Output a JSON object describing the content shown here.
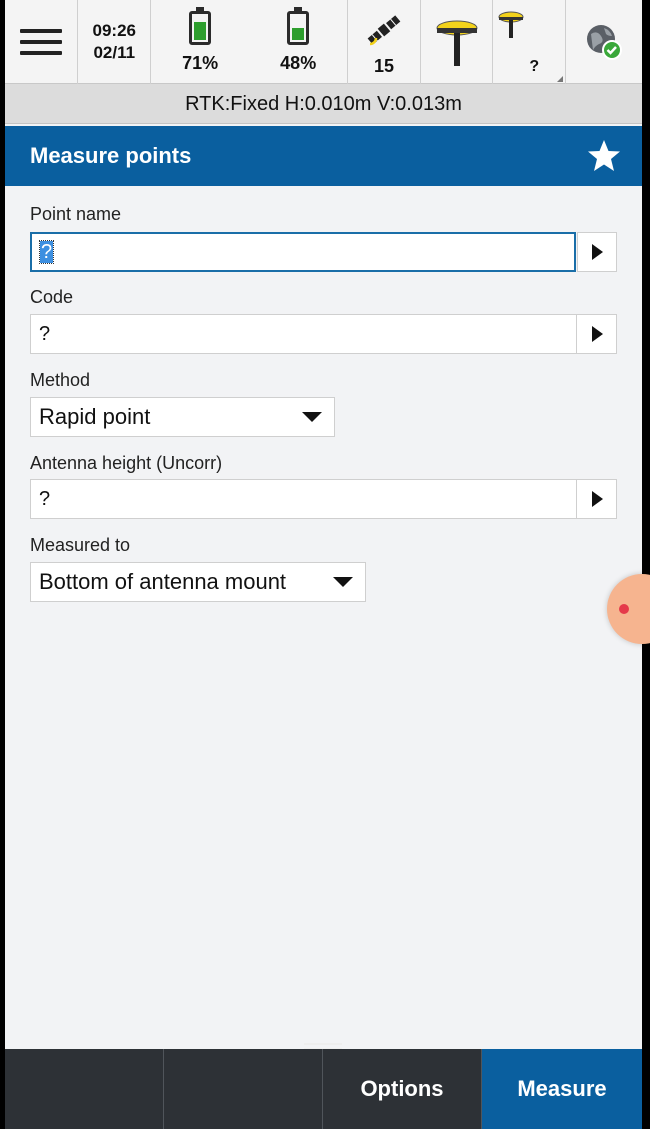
{
  "status": {
    "time": "09:26",
    "date": "02/11",
    "battery1": {
      "label": "71%",
      "level": 0.71
    },
    "battery2": {
      "label": "48%",
      "level": 0.48
    },
    "satellites": "15",
    "base_status": "?",
    "icons": [
      "menu-icon",
      "battery-icon",
      "satellite-icon",
      "gnss-rover-icon",
      "gnss-base-icon",
      "globe-check-icon"
    ]
  },
  "rtk": {
    "text": "RTK:Fixed H:0.010m V:0.013m"
  },
  "header": {
    "title": "Measure points"
  },
  "form": {
    "point_name": {
      "label": "Point name",
      "value": "?"
    },
    "code": {
      "label": "Code",
      "value": "?"
    },
    "method": {
      "label": "Method",
      "value": "Rapid point"
    },
    "antenna_height": {
      "label": "Antenna height (Uncorr)",
      "value": "?"
    },
    "measured_to": {
      "label": "Measured to",
      "value": "Bottom of antenna mount"
    }
  },
  "bottom": {
    "btn1": "",
    "btn2": "",
    "options": "Options",
    "measure": "Measure"
  },
  "colors": {
    "accent": "#0a5f9f",
    "bottom_bar": "#2d3136",
    "battery": "#2e9e2e",
    "gnss_yellow": "#f2d21b"
  }
}
